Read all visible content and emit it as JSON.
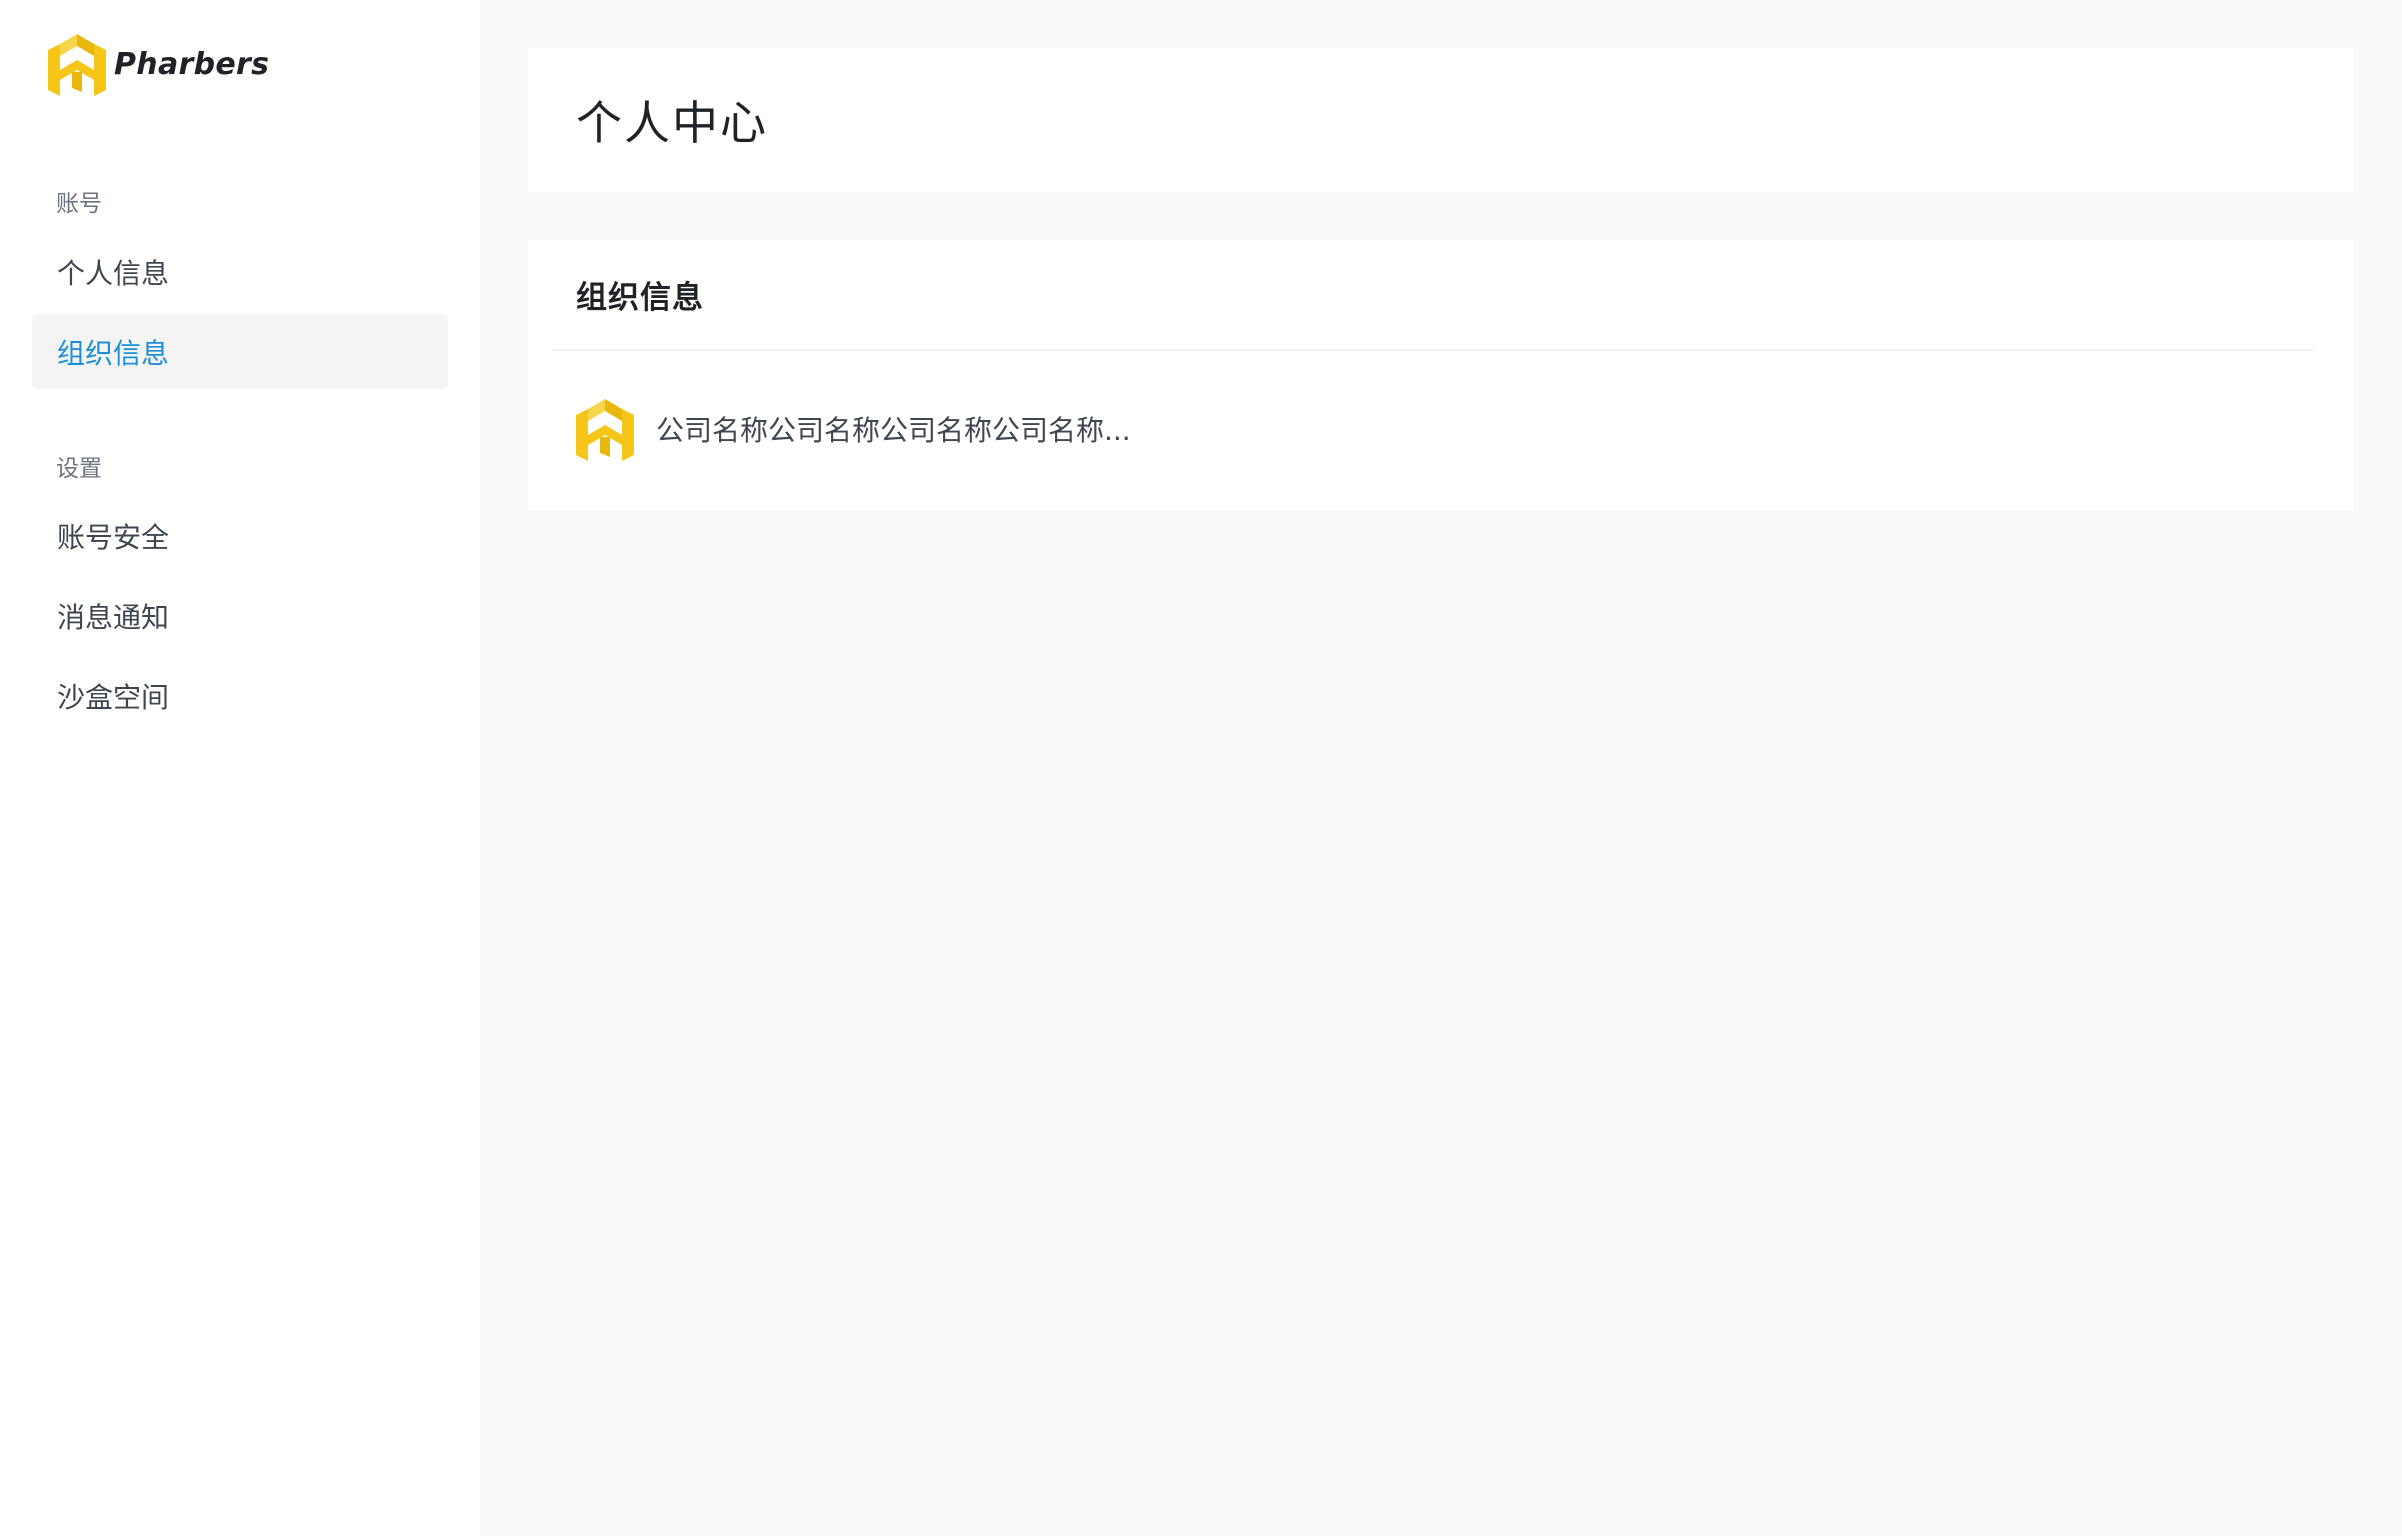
{
  "brand": {
    "name": "Pharbers",
    "logo_icon": "pharbers-logo-icon",
    "logo_color": "#f5c518"
  },
  "sidebar": {
    "sections": [
      {
        "title": "账号",
        "items": [
          {
            "label": "个人信息",
            "active": false
          },
          {
            "label": "组织信息",
            "active": true
          }
        ]
      },
      {
        "title": "设置",
        "items": [
          {
            "label": "账号安全",
            "active": false
          },
          {
            "label": "消息通知",
            "active": false
          },
          {
            "label": "沙盒空间",
            "active": false
          }
        ]
      }
    ],
    "active_color": "#1d8fd6"
  },
  "main": {
    "page_title": "个人中心",
    "org_card": {
      "title": "组织信息",
      "org_logo_icon": "pharbers-logo-icon",
      "org_name": "公司名称公司名称公司名称公司名称..."
    }
  }
}
